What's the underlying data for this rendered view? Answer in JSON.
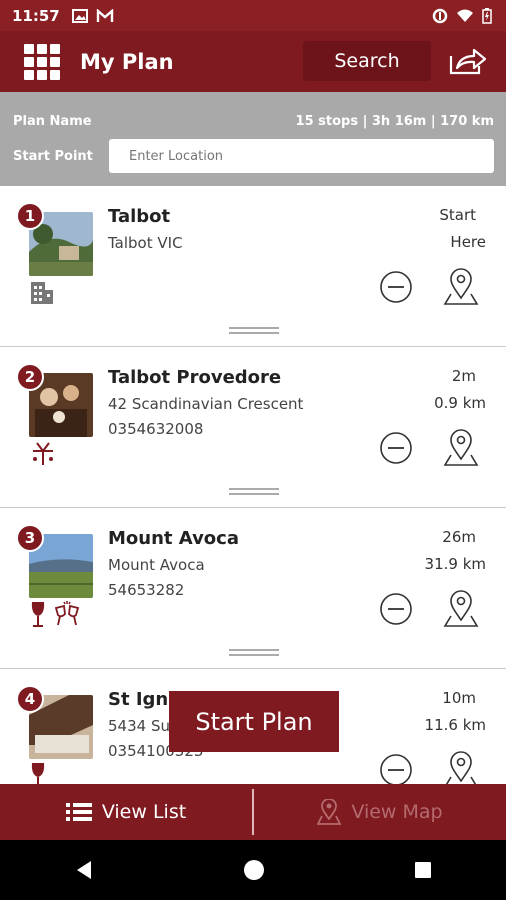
{
  "status_bar": {
    "time": "11:57"
  },
  "header": {
    "title": "My Plan",
    "search_label": "Search"
  },
  "plan": {
    "name_label": "Plan Name",
    "stats": "15 stops | 3h 16m | 170 km",
    "start_label": "Start Point",
    "start_placeholder": "Enter Location"
  },
  "stops": [
    {
      "num": "1",
      "name": "Talbot",
      "line1": "Talbot VIC",
      "line2": "",
      "time": "Start",
      "dist": "Here"
    },
    {
      "num": "2",
      "name": "Talbot Provedore",
      "line1": "42 Scandinavian Crescent",
      "line2": "0354632008",
      "time": "2m",
      "dist": "0.9 km"
    },
    {
      "num": "3",
      "name": "Mount Avoca",
      "line1": "Mount Avoca",
      "line2": "54653282",
      "time": "26m",
      "dist": "31.9 km"
    },
    {
      "num": "4",
      "name": "St Igna",
      "line1": "5434 Su",
      "line2": "0354100323",
      "time": "10m",
      "dist": "11.6 km"
    }
  ],
  "start_plan_label": "Start Plan",
  "tabs": {
    "list_label": "View List",
    "map_label": "View Map"
  },
  "colors": {
    "primary": "#7e1a20",
    "gray_bar": "#a9a9a9"
  }
}
